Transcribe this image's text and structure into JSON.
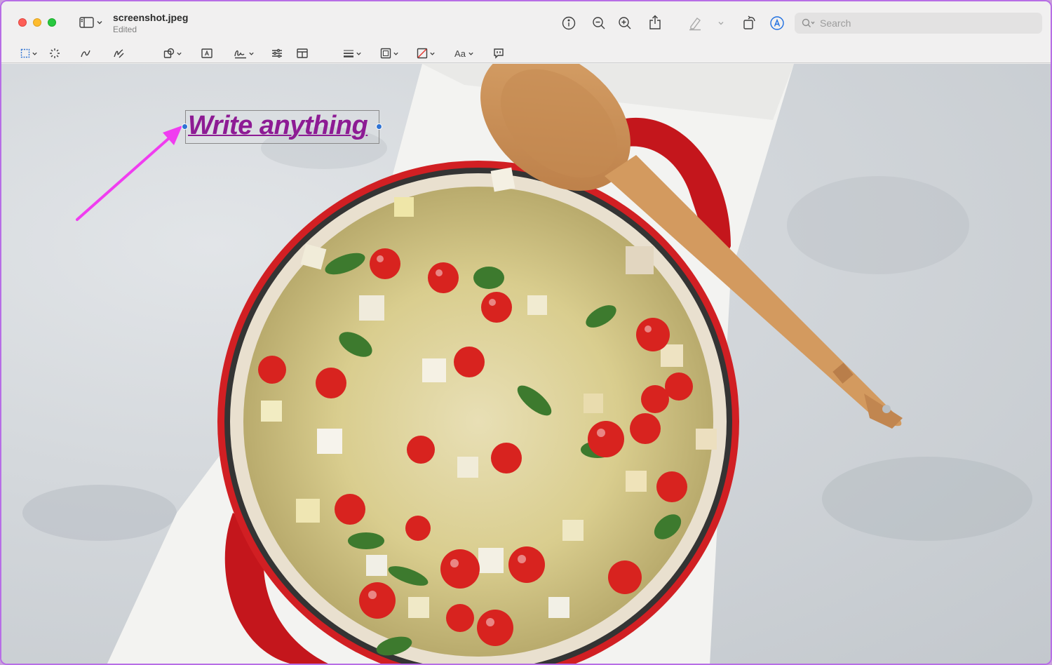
{
  "window": {
    "filename": "screenshot.jpeg",
    "status": "Edited"
  },
  "search": {
    "placeholder": "Search"
  },
  "toolbar": {
    "font_button_label": "Aa"
  },
  "annotation": {
    "text": "Write anything",
    "color": "#8d1b94"
  },
  "arrow": {
    "color": "#f03df0"
  },
  "icons": [
    "sidebar-icon",
    "info-icon",
    "zoom-out-icon",
    "zoom-in-icon",
    "share-icon",
    "highlight-pen-icon",
    "rotate-icon",
    "markup-icon",
    "search-icon",
    "rect-selection-icon",
    "instant-alpha-icon",
    "sketch-icon",
    "draw-icon",
    "shapes-icon",
    "text-box-icon",
    "signature-icon",
    "adjust-color-icon",
    "adjust-size-icon",
    "shape-style-icon",
    "border-color-icon",
    "fill-color-icon",
    "text-style-icon",
    "note-icon"
  ]
}
